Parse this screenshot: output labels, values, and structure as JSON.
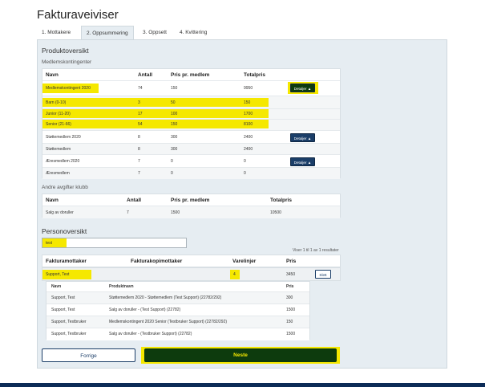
{
  "page_title": "Fakturaveiviser",
  "tabs": [
    {
      "label": "1. Mottakere"
    },
    {
      "label": "2. Oppsummering"
    },
    {
      "label": "3. Oppsett"
    },
    {
      "label": "4. Kvittering"
    }
  ],
  "active_tab": 1,
  "product_overview": {
    "title": "Produktoversikt",
    "membership": {
      "title": "Medlemskontingenter",
      "headers": [
        "Navn",
        "Antall",
        "Pris pr. medlem",
        "Totalpris"
      ],
      "rows": [
        {
          "name": "Medlemskontingent 2020",
          "count": "74",
          "price": "150",
          "total": "9950",
          "button": "Detaljer ▲"
        },
        {
          "name": "Barn (0-10)",
          "count": "3",
          "price": "50",
          "total": "150"
        },
        {
          "name": "Junior (11-20)",
          "count": "17",
          "price": "100",
          "total": "1700"
        },
        {
          "name": "Senior (21-66)",
          "count": "54",
          "price": "150",
          "total": "8100"
        },
        {
          "name": "Støttemedlem 2020",
          "count": "8",
          "price": "300",
          "total": "2400",
          "button": "Detaljer ▲"
        },
        {
          "name": "Støttemedlem",
          "count": "8",
          "price": "300",
          "total": "2400"
        },
        {
          "name": "Æresmedlem 2020",
          "count": "7",
          "price": "0",
          "total": "0",
          "button": "Detaljer ▲"
        },
        {
          "name": "Æresmedlem",
          "count": "7",
          "price": "0",
          "total": "0"
        }
      ]
    },
    "other_fees": {
      "title": "Andre avgifter klubb",
      "headers": [
        "Navn",
        "Antall",
        "Pris pr. medlem",
        "Totalpris"
      ],
      "rows": [
        {
          "name": "Salg av doruller",
          "count": "7",
          "price": "1500",
          "total": "10500"
        }
      ]
    }
  },
  "person_overview": {
    "title": "Personoversikt",
    "search_value": "test",
    "pagination": "Viser 1 til 1 av 1 resultater",
    "headers": [
      "Fakturamottaker",
      "Fakturakopimottaker",
      "Varelinjer",
      "Pris"
    ],
    "rows": [
      {
        "recipient": "Support, Test",
        "copy": "",
        "lines": "4",
        "price": "3450",
        "button": "Slett"
      }
    ],
    "detail_headers": [
      "Navn",
      "Produktnavn",
      "Pris"
    ],
    "details": [
      {
        "name": "Support, Test",
        "product": "Støttemedlem 2020 - Støttemedlem (Test Support) (22782/292)",
        "price": "300"
      },
      {
        "name": "Support, Test",
        "product": "Salg av doruller - (Test Support) (22782)",
        "price": "1500"
      },
      {
        "name": "Support, Testbruker",
        "product": "Medlemskontingent 2020 Senior (Testbruker Support) (22782/292)",
        "price": "150"
      },
      {
        "name": "Support, Testbruker",
        "product": "Salg av doruller - (Testbruker Support) (22782)",
        "price": "1500"
      }
    ]
  },
  "nav": {
    "prev_label": "Forrige",
    "next_label": "Neste"
  },
  "colors": {
    "highlight": "#f5e800",
    "primary": "#1b3e68",
    "next": "#0d3b0d",
    "panel": "#e6edf2"
  }
}
